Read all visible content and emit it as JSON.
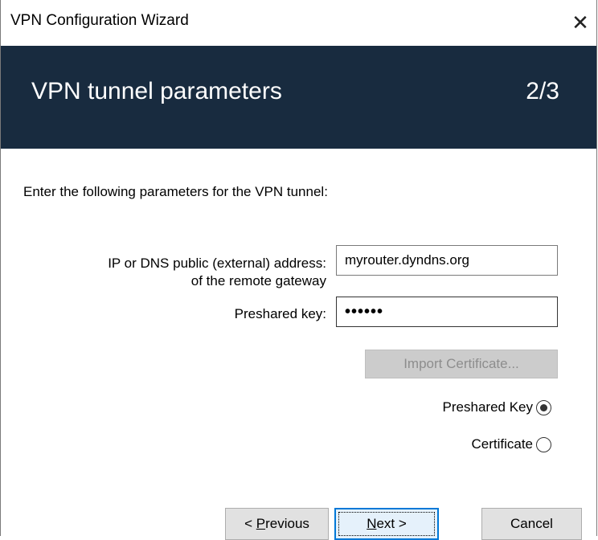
{
  "window": {
    "title": "VPN Configuration Wizard",
    "close_glyph": "✕"
  },
  "banner": {
    "heading": "VPN tunnel parameters",
    "step": "2/3",
    "background_color": "#182b3f"
  },
  "form": {
    "intro": "Enter the following parameters for the VPN tunnel:",
    "address_label_line1": "IP or DNS public (external) address:",
    "address_label_line2": "of the remote gateway",
    "address_value": "myrouter.dyndns.org",
    "key_label": "Preshared key:",
    "key_value_masked": "••••••",
    "import_certificate_label": "Import Certificate...",
    "auth_options": [
      {
        "label": "Preshared Key",
        "selected": true
      },
      {
        "label": "Certificate",
        "selected": false
      }
    ]
  },
  "buttons": {
    "previous_prefix": "< ",
    "previous_mnemonic": "P",
    "previous_rest": "revious",
    "next_mnemonic": "N",
    "next_rest": "ext >",
    "cancel": "Cancel"
  },
  "icons": {
    "close": "close-icon",
    "radio_selected": "radio-selected-icon",
    "radio_unselected": "radio-unselected-icon"
  }
}
